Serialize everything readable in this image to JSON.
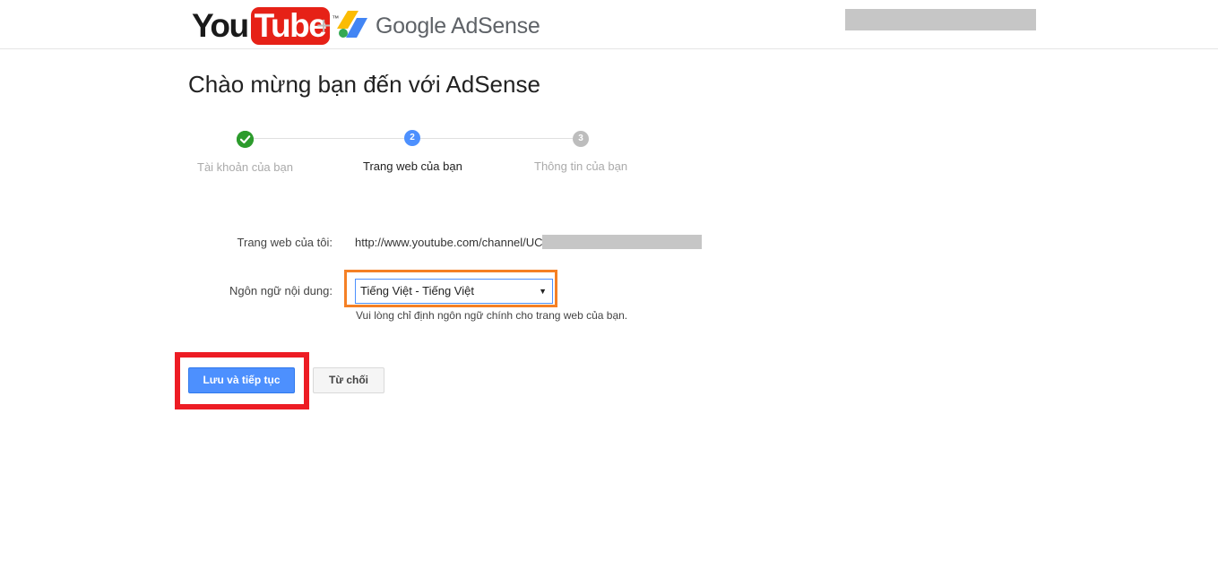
{
  "header": {
    "youtube_you": "You",
    "youtube_tube": "Tube",
    "youtube_tm": "™",
    "plus": "+",
    "adsense_name": "Google AdSense",
    "adsense_icon": "adsense-logo-icon",
    "colors": {
      "youtube_red": "#e62117",
      "adsense_yellow": "#fbbc04",
      "adsense_blue": "#4285f4"
    }
  },
  "title": "Chào mừng bạn đến với AdSense",
  "steps": [
    {
      "number": "",
      "label": "Tài khoản của bạn",
      "state": "done",
      "icon": "check-icon",
      "color": "#2c9b2c"
    },
    {
      "number": "2",
      "label": "Trang web của bạn",
      "state": "current",
      "color": "#4d90fe"
    },
    {
      "number": "3",
      "label": "Thông tin của bạn",
      "state": "upcoming",
      "color": "#bdbdbd"
    }
  ],
  "form": {
    "website_label": "Trang web của tôi:",
    "website_value": "http://www.youtube.com/channel/UC",
    "language_label": "Ngôn ngữ nội dung:",
    "language_selected": "Tiếng Việt - Tiếng Việt",
    "language_hint": "Vui lòng chỉ định ngôn ngữ chính cho trang web của bạn."
  },
  "buttons": {
    "save_continue": "Lưu và tiếp tục",
    "decline": "Từ chối"
  },
  "highlights": {
    "select_frame_color": "#f58025",
    "button_frame_color": "#ed1c24"
  }
}
